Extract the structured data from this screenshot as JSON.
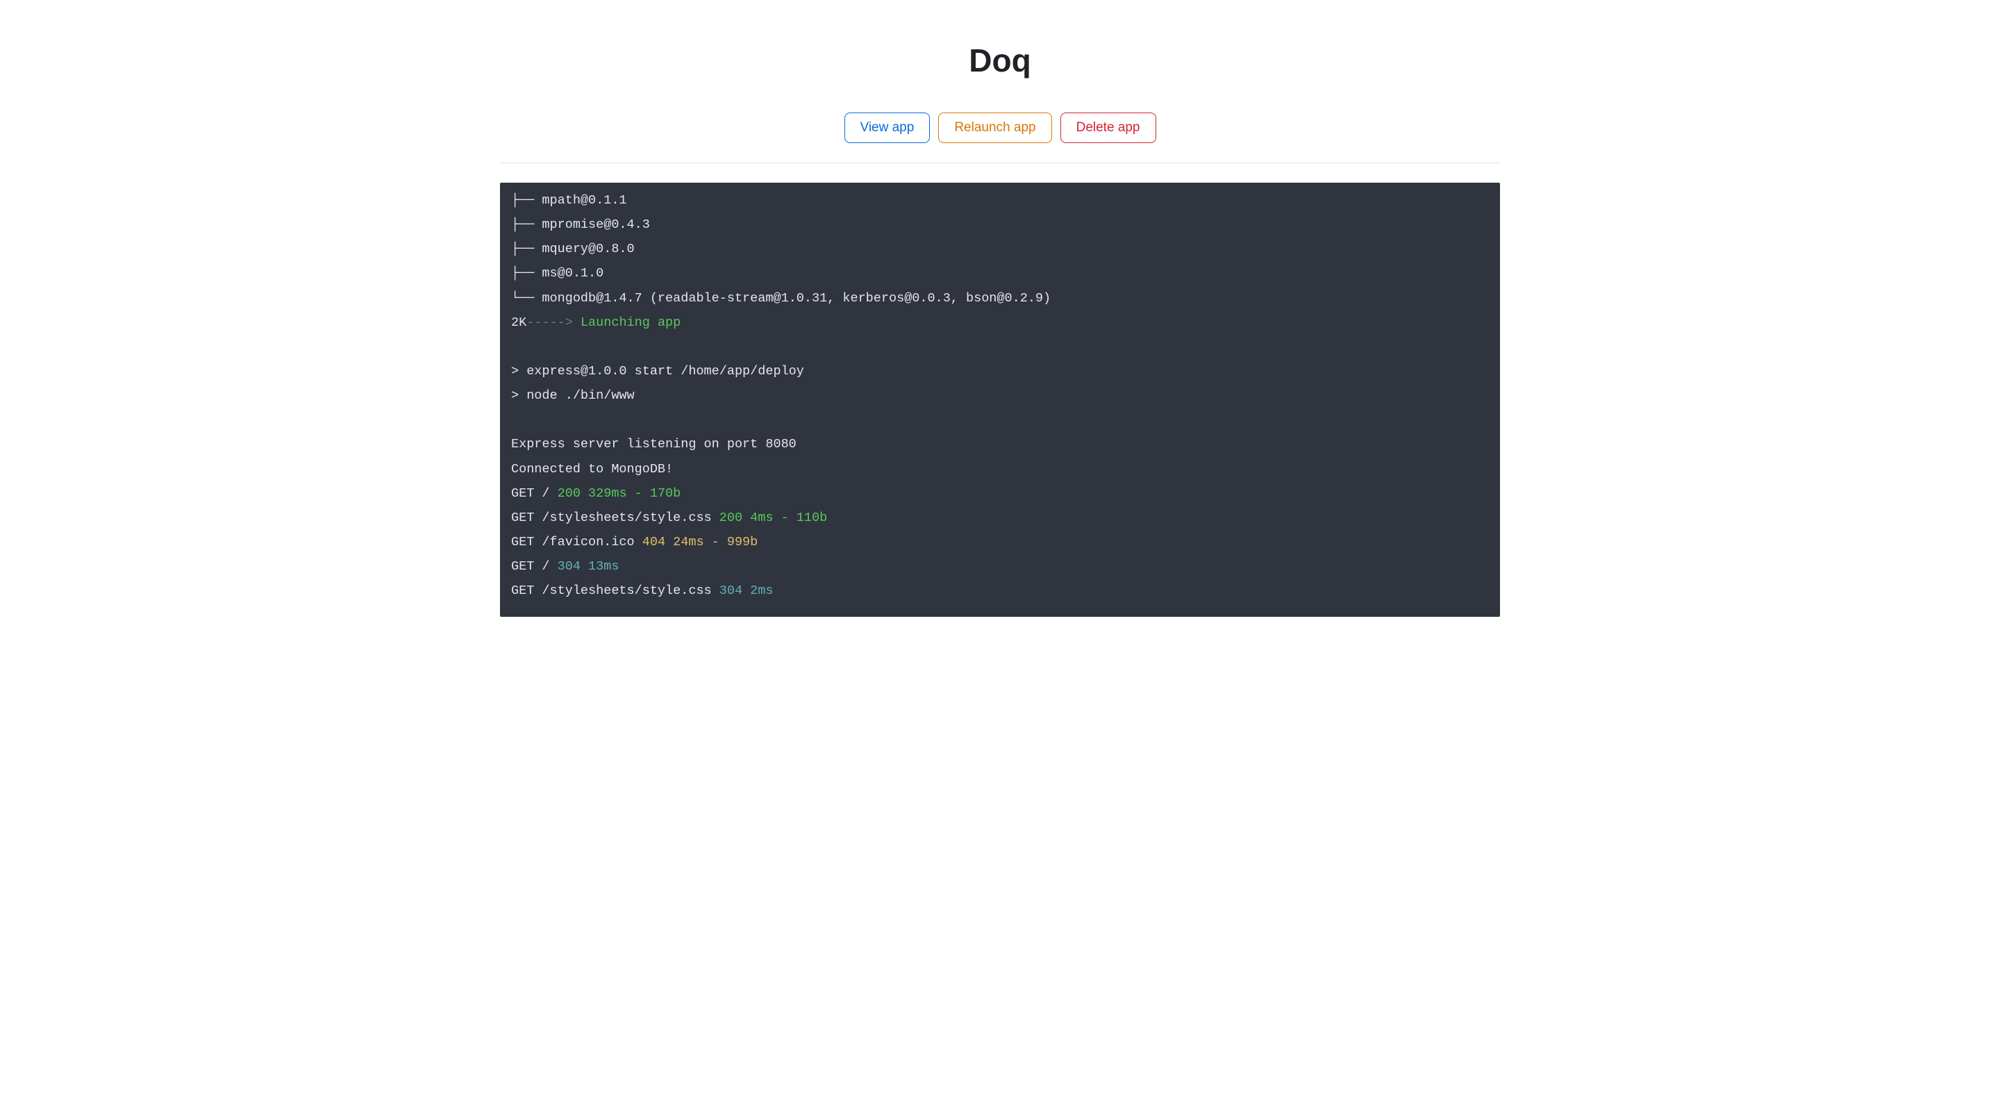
{
  "title": "Doq",
  "buttons": {
    "view": "View app",
    "relaunch": "Relaunch app",
    "delete": "Delete app"
  },
  "terminal": {
    "tree1": "├── mpath@0.1.1",
    "tree2": "├── mpromise@0.4.3",
    "tree3": "├── mquery@0.8.0",
    "tree4": "├── ms@0.1.0",
    "tree5": "└── mongodb@1.4.7 (readable-stream@1.0.31, kerberos@0.0.3, bson@0.2.9)",
    "launch_prefix": "2K",
    "launch_arrow": "-----> ",
    "launch_text": "Launching app",
    "empty1": "",
    "express_start": "> express@1.0.0 start /home/app/deploy",
    "node_start": "> node ./bin/www",
    "empty2": "",
    "listening": "Express server listening on port 8080",
    "mongodb": "Connected to MongoDB!",
    "req1_prefix": "GET / ",
    "req1_status": "200 329ms - 170b",
    "req2_prefix": "GET /stylesheets/style.css ",
    "req2_status": "200 4ms - 110b",
    "req3_prefix": "GET /favicon.ico ",
    "req3_status": "404 24ms - 999b",
    "req4_prefix": "GET / ",
    "req4_status": "304 13ms",
    "req5_prefix": "GET /stylesheets/style.css ",
    "req5_status": "304 2ms"
  }
}
